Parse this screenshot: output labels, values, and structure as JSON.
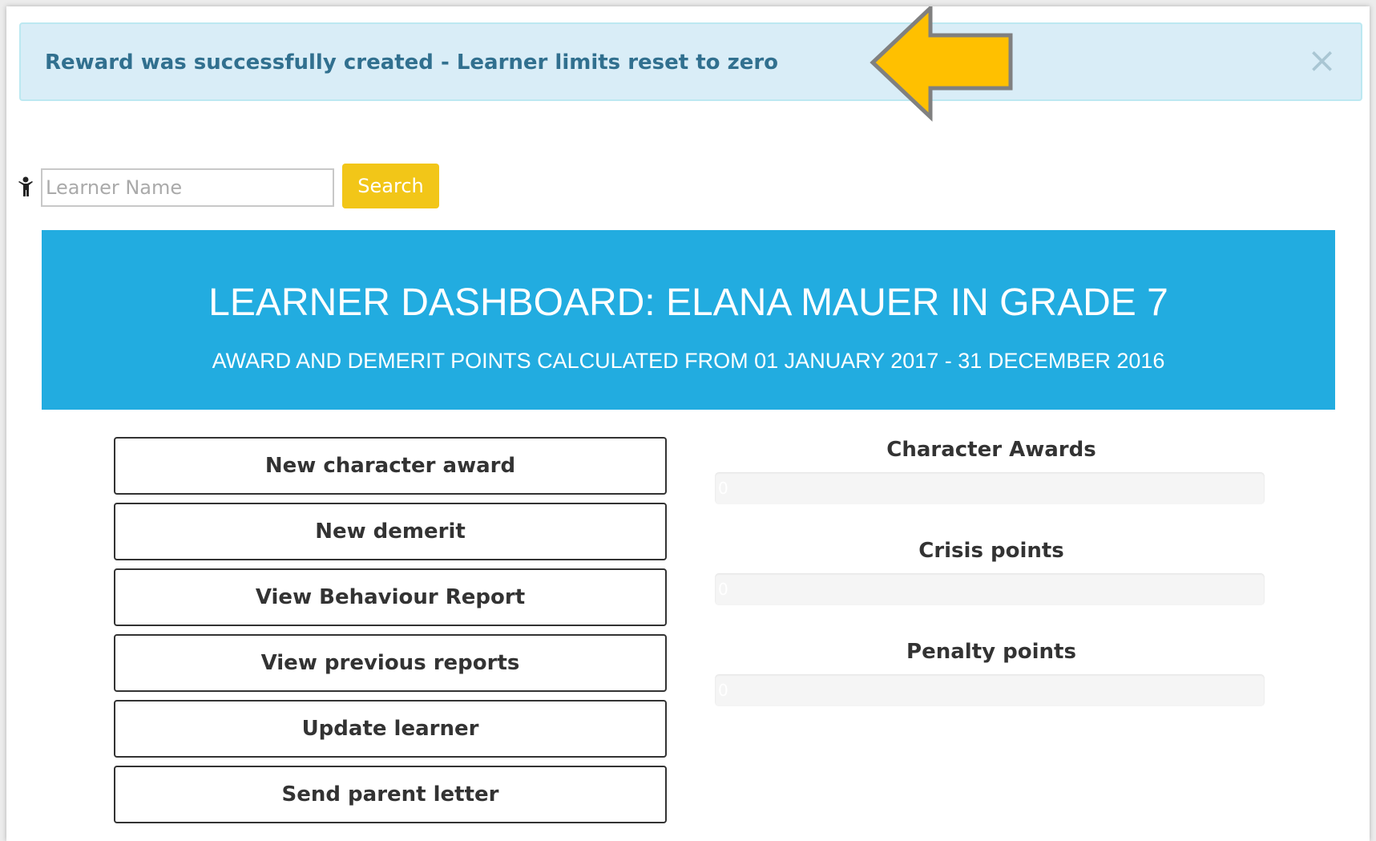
{
  "alert": {
    "message": "Reward was successfully created - Learner limits reset to zero",
    "close_symbol": "×",
    "annotation_arrow_color": "#ffc000"
  },
  "search": {
    "placeholder": "Learner Name",
    "value": "",
    "button_label": "Search",
    "icon": "person-icon"
  },
  "dashboard": {
    "title": "LEARNER DASHBOARD: ELANA MAUER IN GRADE 7",
    "subtitle": "AWARD AND DEMERIT POINTS CALCULATED FROM 01 JANUARY 2017 - 31 DECEMBER 2016",
    "banner_color": "#22ace0"
  },
  "actions": [
    {
      "label": "New character award"
    },
    {
      "label": "New demerit"
    },
    {
      "label": "View Behaviour Report"
    },
    {
      "label": "View previous reports"
    },
    {
      "label": "Update learner"
    },
    {
      "label": "Send parent letter"
    }
  ],
  "stats": [
    {
      "label": "Character Awards",
      "value": "0"
    },
    {
      "label": "Crisis points",
      "value": "0"
    },
    {
      "label": "Penalty points",
      "value": "0"
    }
  ]
}
